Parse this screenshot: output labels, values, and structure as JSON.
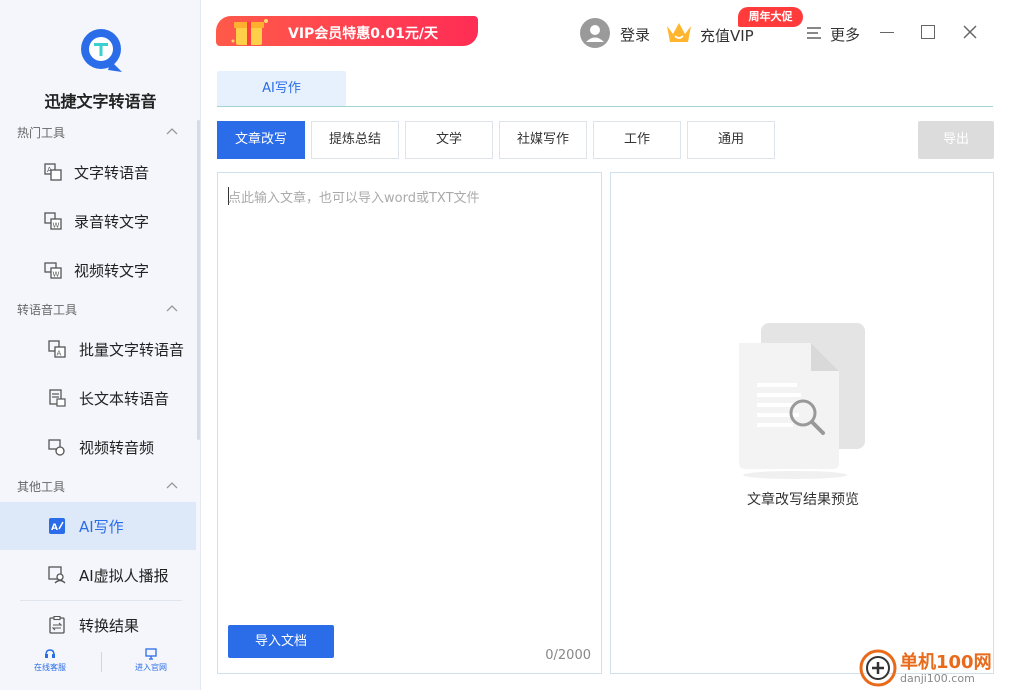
{
  "app": {
    "title": "迅捷文字转语音"
  },
  "sidebar": {
    "sections": [
      {
        "label": "热门工具"
      },
      {
        "label": "转语音工具"
      },
      {
        "label": "其他工具"
      }
    ],
    "items": [
      {
        "label": "文字转语音"
      },
      {
        "label": "录音转文字"
      },
      {
        "label": "视频转文字"
      },
      {
        "label": "批量文字转语音"
      },
      {
        "label": "长文本转语音"
      },
      {
        "label": "视频转音频"
      },
      {
        "label": "AI写作",
        "active": true
      },
      {
        "label": "AI虚拟人播报"
      },
      {
        "label": "转换结果"
      }
    ],
    "bottom": [
      {
        "label": "在线客服"
      },
      {
        "label": "进入官网"
      }
    ]
  },
  "topbar": {
    "promo": "VIP会员特惠0.01元/天",
    "login": "登录",
    "vip": "充值VIP",
    "badge": "周年大促",
    "more": "更多"
  },
  "tabs": [
    {
      "label": "AI写作"
    }
  ],
  "categories": [
    {
      "label": "文章改写",
      "active": true
    },
    {
      "label": "提炼总结"
    },
    {
      "label": "文学"
    },
    {
      "label": "社媒写作"
    },
    {
      "label": "工作"
    },
    {
      "label": "通用"
    }
  ],
  "export_label": "导出",
  "editor": {
    "placeholder": "点此输入文章，也可以导入word或TXT文件",
    "import_label": "导入文档",
    "counter": "0/2000"
  },
  "preview": {
    "label": "文章改写结果预览"
  },
  "watermark": {
    "line1": "单机100网",
    "line2": "danji100.com"
  },
  "colors": {
    "accent": "#2b6de8",
    "promo": "#ff3b5a",
    "badge": "#ff3b3b"
  }
}
